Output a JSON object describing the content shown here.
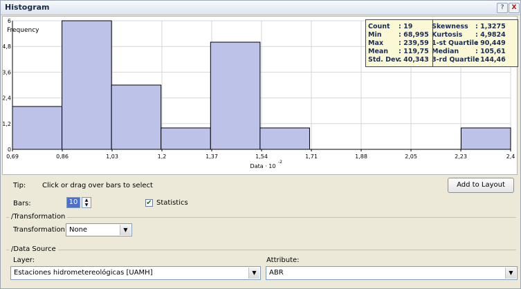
{
  "window": {
    "title": "Histogram",
    "help_label": "?",
    "close_label": "X"
  },
  "chart_data": {
    "type": "bar",
    "ylabel": "Frequency",
    "xlabel": "Data",
    "xlabel_exponent": "-2",
    "xlabel_multiplier": "10",
    "xlim": [
      0.69,
      2.4
    ],
    "ylim": [
      0,
      6
    ],
    "x_ticks": [
      "0,69",
      "0,86",
      "1,03",
      "1,2",
      "1,37",
      "1,54",
      "1,71",
      "1,88",
      "2,05",
      "2,23",
      "2,4"
    ],
    "y_ticks": [
      "0",
      "1,2",
      "2,4",
      "3,6",
      "4,8",
      "6"
    ],
    "bins": [
      {
        "from": 0.69,
        "to": 0.86,
        "value": 2
      },
      {
        "from": 0.86,
        "to": 1.03,
        "value": 6
      },
      {
        "from": 1.03,
        "to": 1.2,
        "value": 3
      },
      {
        "from": 1.2,
        "to": 1.37,
        "value": 1
      },
      {
        "from": 1.37,
        "to": 1.54,
        "value": 5
      },
      {
        "from": 1.54,
        "to": 1.71,
        "value": 1
      },
      {
        "from": 1.71,
        "to": 1.88,
        "value": 0
      },
      {
        "from": 1.88,
        "to": 2.05,
        "value": 0
      },
      {
        "from": 2.05,
        "to": 2.23,
        "value": 0
      },
      {
        "from": 2.23,
        "to": 2.4,
        "value": 1
      }
    ],
    "grid": true,
    "bar_color": "#bcc2e8",
    "bar_edge": "#000000"
  },
  "statistics": {
    "left": [
      {
        "label": "Count",
        "value": ": 19"
      },
      {
        "label": "Min",
        "value": ": 68,995"
      },
      {
        "label": "Max",
        "value": ": 239,59"
      },
      {
        "label": "Mean",
        "value": ": 119,75"
      },
      {
        "label": "Std. Dev.",
        "value": ": 40,343"
      }
    ],
    "right": [
      {
        "label": "Skewness",
        "value": ": 1,3275"
      },
      {
        "label": "Kurtosis",
        "value": ": 4,9824"
      },
      {
        "label": "1-st Quartile",
        "value": ": 90,449"
      },
      {
        "label": "Median",
        "value": ": 105,61"
      },
      {
        "label": "3-rd Quartile",
        "value": ": 144,46"
      }
    ]
  },
  "controls": {
    "tip_label": "Tip:",
    "tip_text": "Click or drag over bars to select",
    "add_to_layout": "Add to Layout",
    "bars_label": "Bars:",
    "bars_value": "10",
    "statistics_label": "Statistics",
    "statistics_checked": "✔",
    "transformation_group": "Transformation",
    "transformation_label": "Transformation:",
    "transformation_value": "None",
    "data_source_group": "Data Source",
    "layer_label": "Layer:",
    "layer_value": "Estaciones hidrometereológicas [UAMH]",
    "attribute_label": "Attribute:",
    "attribute_value": "ABR"
  }
}
